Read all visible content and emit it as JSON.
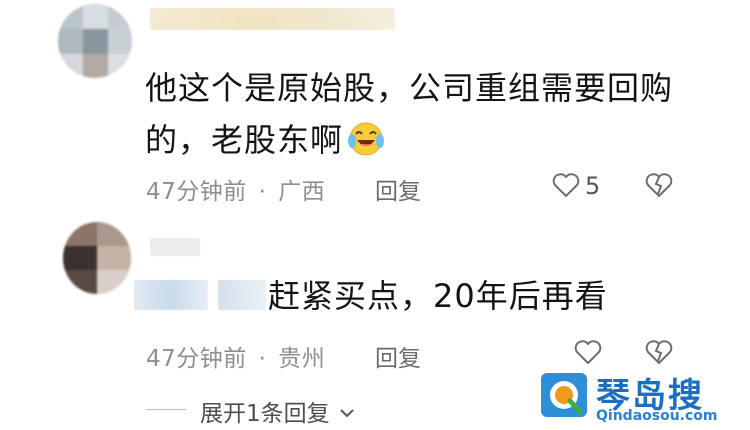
{
  "comments": [
    {
      "text_line1": "他这个是原始股，公司重组需要回购",
      "text_line2": "的，老股东啊",
      "emoji": "laughing-crying-emoji",
      "time": "47分钟前",
      "separator": "·",
      "location": "广西",
      "reply_label": "回复",
      "likes": "5"
    },
    {
      "text": "赶紧买点，20年后再看",
      "time": "47分钟前",
      "separator": "·",
      "location": "贵州",
      "reply_label": "回复"
    }
  ],
  "expand_replies": {
    "label": "展开1条回复",
    "chevron": "chevron-down-icon"
  },
  "watermark": {
    "name": "琴岛搜",
    "domain": "Qindaosou.com"
  },
  "colors": {
    "meta_gray": "#8e8e8e",
    "watermark_blue": "#1b6fc2"
  }
}
